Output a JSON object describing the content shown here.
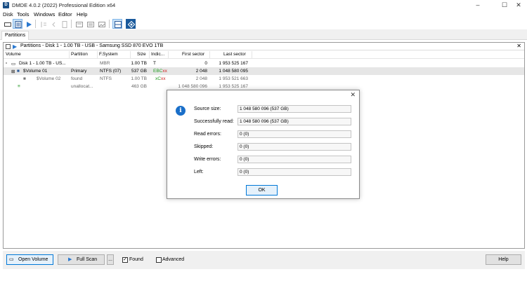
{
  "window": {
    "title": "DMDE 4.0.2 (2022) Professional Edition x64",
    "app_icon": "D"
  },
  "menu": [
    "Disk",
    "Tools",
    "Windows",
    "Editor",
    "Help"
  ],
  "tabs": [
    "Partitions"
  ],
  "panel": {
    "title": "Partitions - Disk 1 - 1.00 TB - USB - Samsung SSD 870 EVO 1TB",
    "columns": [
      "Volume",
      "Partition",
      "F.System",
      "Size",
      "Indic...",
      "First sector",
      "Last sector"
    ],
    "rows": [
      {
        "volume": "Disk 1 - 1.00 TB - US...",
        "partition": "",
        "fs": "MBR",
        "size": "1.00 TB",
        "indic": "T",
        "first": "0",
        "last": "1 953 525 167"
      },
      {
        "volume": "$Volume 01",
        "partition": "Primary",
        "fs": "NTFS (07)",
        "size": "537 GB",
        "indic_a": "EBC",
        "indic_b": "x",
        "indic_c": "x",
        "first": "2 048",
        "last": "1 048 580 095"
      },
      {
        "volume": "$Volume 02",
        "partition": "found",
        "fs": "NTFS",
        "size": "1.00 TB",
        "indic_a": "xC",
        "indic_b": "x",
        "indic_c": "x",
        "first": "2 048",
        "last": "1 953 521 663"
      },
      {
        "volume": "",
        "partition": "unallocat...",
        "fs": "",
        "size": "463 GB",
        "indic": "",
        "first": "1 048 580 096",
        "last": "1 953 525 167"
      }
    ]
  },
  "bottom": {
    "open_volume": "Open Volume",
    "full_scan": "Full Scan",
    "more": "...",
    "found_label": "Found",
    "found_checked": true,
    "advanced_label": "Advanced",
    "advanced_checked": false,
    "help": "Help"
  },
  "dialog": {
    "fields": [
      {
        "label": "Source size:",
        "value": "1 048 580 096 (537 GB)"
      },
      {
        "label": "Successfully read:",
        "value": "1 048 580 096 (537 GB)"
      },
      {
        "label": "Read errors:",
        "value": "0 (0)"
      },
      {
        "label": "Skipped:",
        "value": "0 (0)"
      },
      {
        "label": "Write errors:",
        "value": "0 (0)"
      },
      {
        "label": "Left:",
        "value": "0 (0)"
      }
    ],
    "ok": "OK"
  },
  "colors": {
    "accent": "#0078d7",
    "info": "#1a6fc9",
    "indic_green": "#1f9a1f",
    "indic_red": "#d02020"
  }
}
